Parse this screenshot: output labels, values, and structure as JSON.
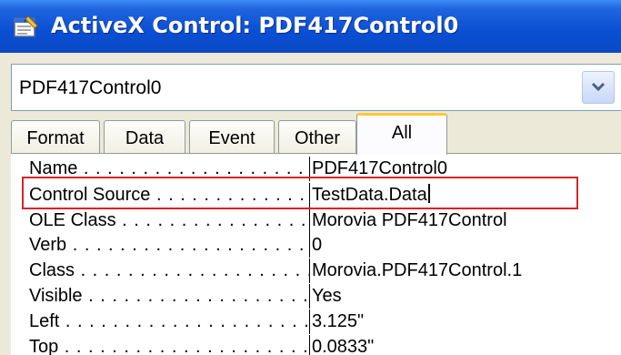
{
  "window": {
    "title": "ActiveX Control: PDF417Control0"
  },
  "combo": {
    "selected": "PDF417Control0"
  },
  "tabs": [
    {
      "label": "Format",
      "active": false
    },
    {
      "label": "Data",
      "active": false
    },
    {
      "label": "Event",
      "active": false
    },
    {
      "label": "Other",
      "active": false
    },
    {
      "label": "All",
      "active": true
    }
  ],
  "properties": [
    {
      "name": "Name",
      "value": "PDF417Control0"
    },
    {
      "name": "Control Source",
      "value": "TestData.Data"
    },
    {
      "name": "OLE Class",
      "value": "Morovia PDF417Control"
    },
    {
      "name": "Verb",
      "value": "0"
    },
    {
      "name": "Class",
      "value": "Morovia.PDF417Control.1"
    },
    {
      "name": "Visible",
      "value": "Yes"
    },
    {
      "name": "Left",
      "value": "3.125\""
    },
    {
      "name": "Top",
      "value": "0.0833\""
    }
  ],
  "colors": {
    "title_bar": "#0a4fd3",
    "active_tab_accent": "#ffc83c",
    "highlight": "#d8232a"
  }
}
